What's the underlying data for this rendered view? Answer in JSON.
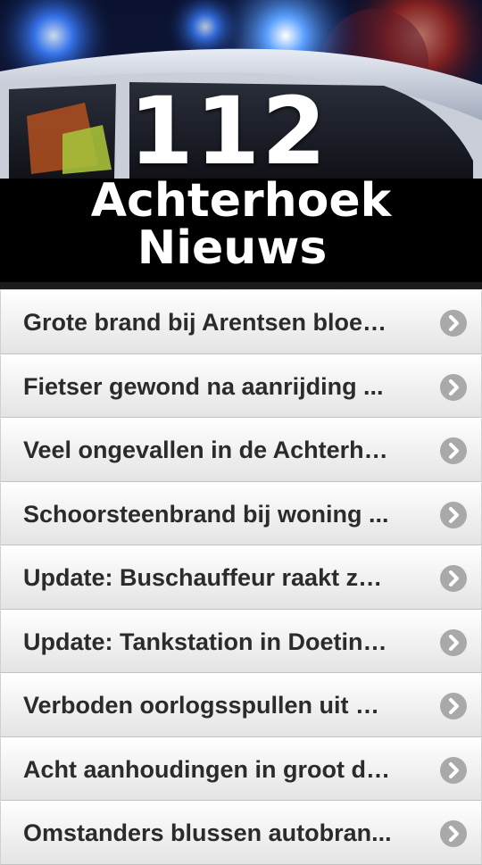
{
  "banner": {
    "number": "112",
    "line1": "Achterhoek",
    "line2": "Nieuws"
  },
  "news": [
    {
      "title": "Grote brand bij Arentsen bloem..."
    },
    {
      "title": "Fietser gewond na aanrijding ..."
    },
    {
      "title": "Veel ongevallen in de Achterho..."
    },
    {
      "title": "Schoorsteenbrand bij woning ..."
    },
    {
      "title": "Update: Buschauffeur raakt zw..."
    },
    {
      "title": "Update: Tankstation in Doetinc..."
    },
    {
      "title": "Verboden oorlogsspullen uit w..."
    },
    {
      "title": "Acht aanhoudingen in groot dr..."
    },
    {
      "title": "Omstanders blussen autobran..."
    }
  ],
  "icons": {
    "row_arrow": "chevron-right-icon"
  }
}
